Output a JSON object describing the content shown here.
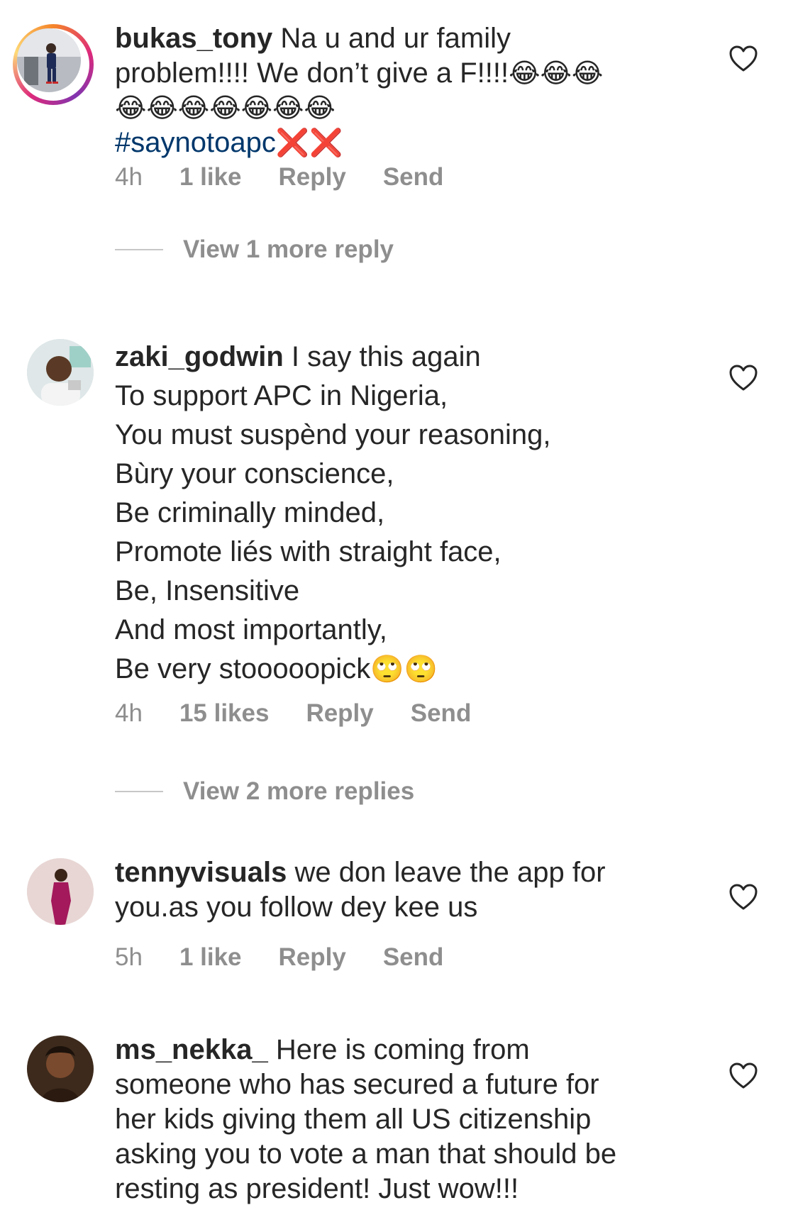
{
  "comments": [
    {
      "username": "bukas_tony",
      "text_line1": " Na u and ur family",
      "text_line2": "problem!!!! We don’t give a F!!!!",
      "emoji_line2": "😂😂😂",
      "emoji_line3": "😂😂😂😂😂😂😂",
      "hashtag": "#saynotoapc",
      "hashtag_emoji": "❌❌",
      "time": "4h",
      "likes": "1 like",
      "reply": "Reply",
      "send": "Send",
      "view_more": "View 1 more reply"
    },
    {
      "username": "zaki_godwin",
      "lines": [
        " I say this again",
        "To support APC in Nigeria,",
        "You must suspènd your reasoning,",
        "Bùry your conscience,",
        "Be criminally minded,",
        "Promote liés with straight face,",
        "Be, Insensitive",
        "And most importantly,",
        "Be very stooooopick"
      ],
      "end_emoji": "🙄🙄",
      "time": "4h",
      "likes": "15 likes",
      "reply": "Reply",
      "send": "Send",
      "view_more": "View 2 more replies"
    },
    {
      "username": "tennyvisuals",
      "text_line1": " we don leave the app for",
      "text_line2": "you.as you follow dey kee us",
      "time": "5h",
      "likes": "1 like",
      "reply": "Reply",
      "send": "Send"
    },
    {
      "username": "ms_nekka_",
      "text_line1": " Here is coming from",
      "text_line2": "someone who has secured a future for",
      "text_line3": "her kids giving them all US citizenship",
      "text_line4": "asking you to vote a man that should be",
      "text_line5": "resting as president! Just wow!!!"
    }
  ],
  "icons": {
    "like": "heart-outline-icon"
  },
  "colors": {
    "username": "#262626",
    "meta": "#8e8e8e",
    "hashtag": "#00376b"
  }
}
